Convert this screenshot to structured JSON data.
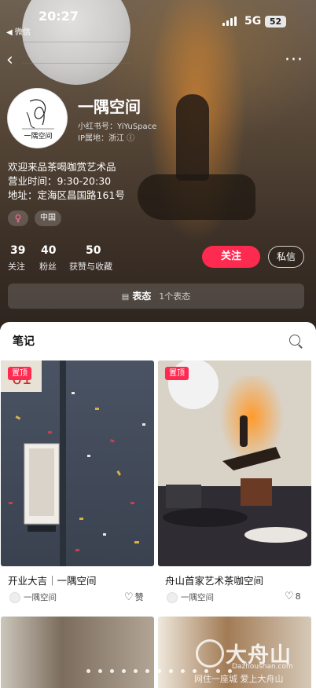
{
  "status_bar": {
    "time": "20:27",
    "back_app": "◀ 微信",
    "network": "5G",
    "battery": "52"
  },
  "nav": {
    "back_glyph": "‹",
    "more_glyph": "···"
  },
  "profile": {
    "avatar_text": "一隅空间",
    "name": "一隅空间",
    "redbook_id": "小红书号：YiYuSpace",
    "ip_location": "IP属地：浙江 ⓘ",
    "bio_lines": [
      "欢迎来品茶喝咖赏艺术品",
      "营业时间：9:30-20:30",
      "地址：定海区昌国路161号"
    ],
    "tags": {
      "gender": "♀",
      "region": "中国"
    }
  },
  "stats": [
    {
      "value": "39",
      "label": "关注"
    },
    {
      "value": "40",
      "label": "粉丝"
    },
    {
      "value": "50",
      "label": "获赞与收藏"
    }
  ],
  "actions": {
    "follow": "关注",
    "message": "私信"
  },
  "mood": {
    "icon": "chat-icon",
    "label": "表态",
    "count": "1个表态"
  },
  "notes": {
    "title": "笔记",
    "cards": [
      {
        "pinned": "置顶",
        "title": "开业大吉｜一隅空间",
        "author": "一隅空间",
        "likes": "赞"
      },
      {
        "pinned": "置顶",
        "title": "舟山首家艺术茶咖空间",
        "author": "一隅空间",
        "likes": "8"
      }
    ]
  },
  "watermark": {
    "brand": "大舟山",
    "url": "Dazhoushan.com",
    "slogan": "网住一座城 爱上大舟山"
  },
  "colors": {
    "accent": "#ff2a50"
  }
}
